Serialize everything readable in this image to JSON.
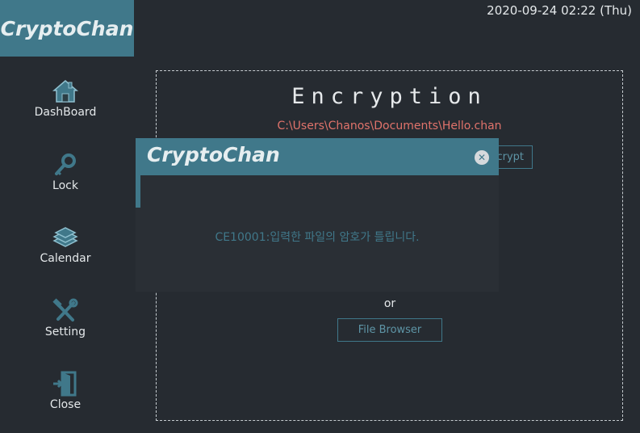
{
  "app": {
    "logo": "CryptoChan"
  },
  "datetime": "2020-09-24 02:22 (Thu)",
  "sidebar": {
    "items": [
      {
        "label": "DashBoard",
        "icon": "home-icon"
      },
      {
        "label": "Lock",
        "icon": "key-icon"
      },
      {
        "label": "Calendar",
        "icon": "book-stack-icon"
      },
      {
        "label": "Setting",
        "icon": "tools-icon"
      },
      {
        "label": "Close",
        "icon": "exit-door-icon"
      }
    ]
  },
  "main": {
    "title": "Encryption",
    "file_path": "C:\\Users\\Chanos\\Documents\\Hello.chan",
    "decrypt_label": "crypt",
    "or_text": "or",
    "file_browser_label": "File Browser"
  },
  "dialog": {
    "title": "CryptoChan",
    "close_icon": "close-icon",
    "error_code": "CE10001:",
    "error_text": "입력한 파일의 암호가 틀립니다."
  },
  "colors": {
    "background": "#262b31",
    "accent": "#40788a",
    "path": "#e0736b"
  }
}
